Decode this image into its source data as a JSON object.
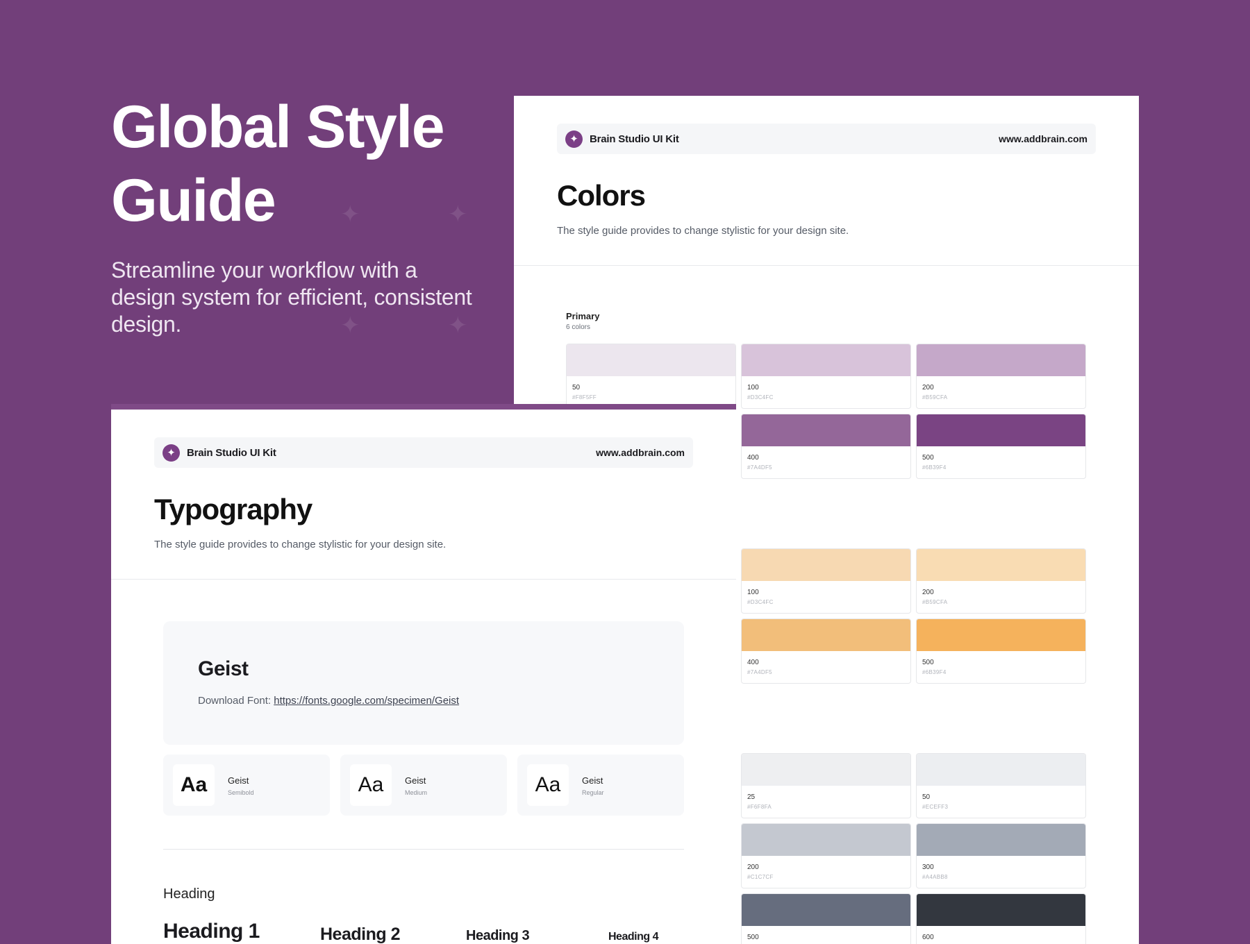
{
  "hero": {
    "title": "Global Style Guide",
    "subtitle": "Streamline your workflow with a design system for efficient, consistent design."
  },
  "colors_card": {
    "brand": {
      "name": "Brain Studio UI Kit",
      "logo_icon": "sparkle-icon"
    },
    "url": "www.addbrain.com",
    "title": "Colors",
    "description": "The style guide provides to change stylistic for your design site.",
    "groups": [
      {
        "title": "Primary",
        "count": "6 colors",
        "swatches": [
          {
            "name": "50",
            "hex": "#F8F5FF",
            "color": "#ece6ee"
          },
          {
            "name": "100",
            "hex": "#D3C4FC",
            "color": "#d8c3da"
          },
          {
            "name": "200",
            "hex": "#B59CFA",
            "color": "#c5a8c9"
          },
          {
            "name": "400",
            "hex": "#7A4DF5",
            "color": "#946799"
          },
          {
            "name": "500",
            "hex": "#6B39F4",
            "color": "#7a4483"
          }
        ]
      },
      {
        "title": "",
        "count": "",
        "swatches": [
          {
            "name": "100",
            "hex": "#D3C4FC",
            "color": "#f7d9b2"
          },
          {
            "name": "200",
            "hex": "#B59CFA",
            "color": "#f9dcb3"
          },
          {
            "name": "400",
            "hex": "#7A4DF5",
            "color": "#f2be7a"
          },
          {
            "name": "500",
            "hex": "#6B39F4",
            "color": "#f5b25c"
          }
        ]
      },
      {
        "title": "",
        "count": "",
        "swatches": [
          {
            "name": "25",
            "hex": "#F6F8FA",
            "color": "#eeeff1"
          },
          {
            "name": "50",
            "hex": "#ECEFF3",
            "color": "#eceef1"
          },
          {
            "name": "200",
            "hex": "#C1C7CF",
            "color": "#c4c8d0"
          },
          {
            "name": "300",
            "hex": "#A4ABB8",
            "color": "#a3aab6"
          },
          {
            "name": "500",
            "hex": "",
            "color": "#666d7e"
          },
          {
            "name": "600",
            "hex": "",
            "color": "#33373f"
          }
        ]
      }
    ]
  },
  "typography_card": {
    "brand": {
      "name": "Brain Studio UI Kit",
      "logo_icon": "sparkle-icon"
    },
    "url": "www.addbrain.com",
    "title": "Typography",
    "description": "The style guide provides to change stylistic for your design site.",
    "font": {
      "name": "Geist",
      "download_label": "Download Font:",
      "download_link": "https://fonts.google.com/specimen/Geist"
    },
    "weights": [
      {
        "sample": "Aa",
        "font": "Geist",
        "style": "Semibold"
      },
      {
        "sample": "Aa",
        "font": "Geist",
        "style": "Medium"
      },
      {
        "sample": "Aa",
        "font": "Geist",
        "style": "Regular"
      }
    ],
    "heading_section": {
      "label": "Heading",
      "samples": [
        "Heading 1",
        "Heading 2",
        "Heading 3",
        "Heading 4"
      ]
    }
  }
}
